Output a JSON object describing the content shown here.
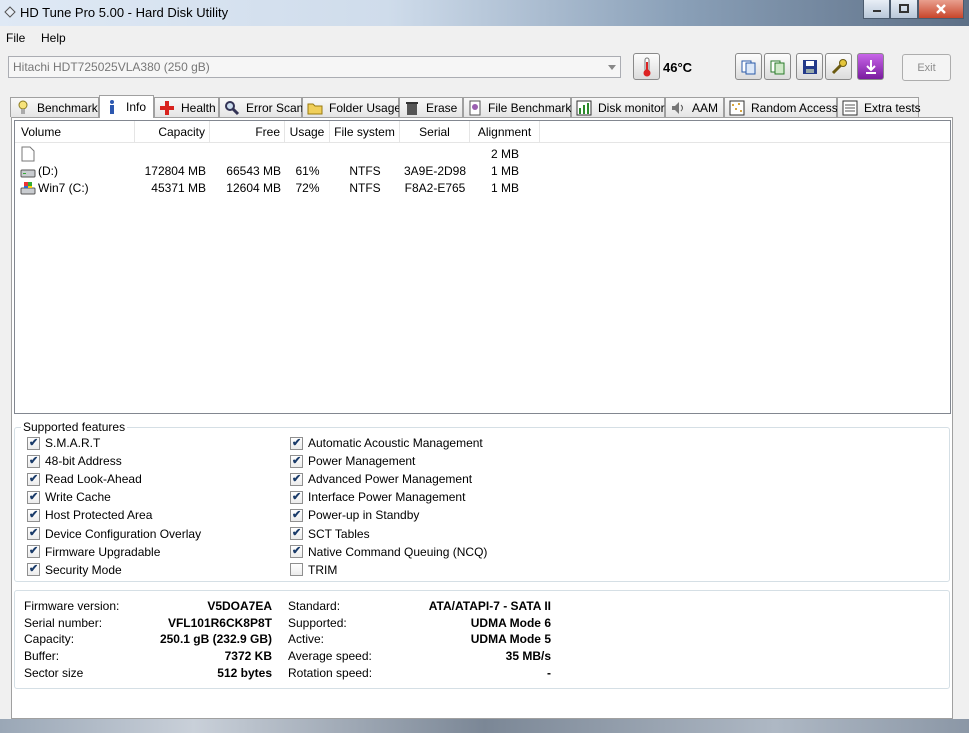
{
  "window": {
    "title": "HD Tune Pro 5.00 - Hard Disk Utility"
  },
  "menu": [
    {
      "label": "File"
    },
    {
      "label": "Help"
    }
  ],
  "toolbar": {
    "drive": "Hitachi HDT725025VLA380 (250 gB)",
    "temperature": "46°C",
    "exit_label": "Exit"
  },
  "tabs": [
    {
      "label": "Benchmark",
      "icon": "benchmark-icon"
    },
    {
      "label": "Info",
      "icon": "info-icon"
    },
    {
      "label": "Health",
      "icon": "health-cross-icon"
    },
    {
      "label": "Error Scan",
      "icon": "magnifier-icon"
    },
    {
      "label": "Folder Usage",
      "icon": "folder-icon"
    },
    {
      "label": "Erase",
      "icon": "trash-icon"
    },
    {
      "label": "File Benchmark",
      "icon": "file-benchmark-icon"
    },
    {
      "label": "Disk monitor",
      "icon": "disk-monitor-icon"
    },
    {
      "label": "AAM",
      "icon": "speaker-icon"
    },
    {
      "label": "Random Access",
      "icon": "random-access-icon"
    },
    {
      "label": "Extra tests",
      "icon": "extra-tests-icon"
    }
  ],
  "volumes": {
    "columns": [
      "Volume",
      "Capacity",
      "Free",
      "Usage",
      "File system",
      "Serial",
      "Alignment"
    ],
    "rows": [
      {
        "volume": "",
        "capacity": "",
        "free": "",
        "usage": "",
        "fs": "",
        "serial": "",
        "alignment": "2 MB",
        "icon": "blank-file-icon"
      },
      {
        "volume": "(D:)",
        "capacity": "172804 MB",
        "free": "66543 MB",
        "usage": "61%",
        "fs": "NTFS",
        "serial": "3A9E-2D98",
        "alignment": "1 MB",
        "icon": "drive-icon"
      },
      {
        "volume": "Win7 (C:)",
        "capacity": "45371 MB",
        "free": "12604 MB",
        "usage": "72%",
        "fs": "NTFS",
        "serial": "F8A2-E765",
        "alignment": "1 MB",
        "icon": "system-drive-icon"
      }
    ]
  },
  "features": {
    "title": "Supported features",
    "left": [
      {
        "label": "S.M.A.R.T",
        "checked": true
      },
      {
        "label": "48-bit Address",
        "checked": true
      },
      {
        "label": "Read Look-Ahead",
        "checked": true
      },
      {
        "label": "Write Cache",
        "checked": true
      },
      {
        "label": "Host Protected Area",
        "checked": true
      },
      {
        "label": "Device Configuration Overlay",
        "checked": true
      },
      {
        "label": "Firmware Upgradable",
        "checked": true
      },
      {
        "label": "Security Mode",
        "checked": true
      }
    ],
    "right": [
      {
        "label": "Automatic Acoustic Management",
        "checked": true
      },
      {
        "label": "Power Management",
        "checked": true
      },
      {
        "label": "Advanced Power Management",
        "checked": true
      },
      {
        "label": "Interface Power Management",
        "checked": true
      },
      {
        "label": "Power-up in Standby",
        "checked": true
      },
      {
        "label": "SCT Tables",
        "checked": true
      },
      {
        "label": "Native Command Queuing (NCQ)",
        "checked": true
      },
      {
        "label": "TRIM",
        "checked": false
      }
    ]
  },
  "details": {
    "left": [
      {
        "key": "Firmware version:",
        "value": "V5DOA7EA"
      },
      {
        "key": "Serial number:",
        "value": "VFL101R6CK8P8T"
      },
      {
        "key": "Capacity:",
        "value": "250.1 gB (232.9 GB)"
      },
      {
        "key": "Buffer:",
        "value": "7372 KB"
      },
      {
        "key": "Sector size",
        "value": "512 bytes"
      }
    ],
    "right": [
      {
        "key": "Standard:",
        "value": "ATA/ATAPI-7 - SATA II"
      },
      {
        "key": "Supported:",
        "value": "UDMA Mode 6"
      },
      {
        "key": "Active:",
        "value": "UDMA Mode 5"
      },
      {
        "key": "Average speed:",
        "value": "35 MB/s"
      },
      {
        "key": "Rotation speed:",
        "value": "-"
      }
    ]
  }
}
